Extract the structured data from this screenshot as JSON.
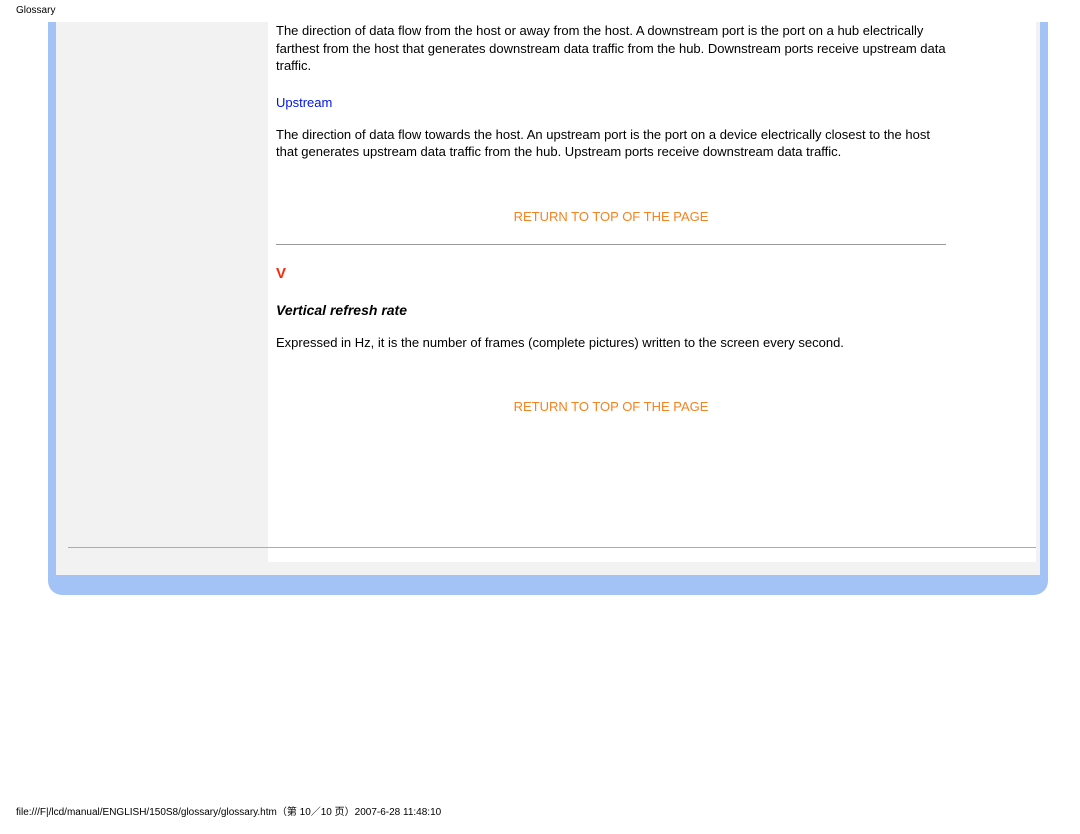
{
  "header": {
    "label": "Glossary"
  },
  "content": {
    "downstream_paragraph": "The direction of data flow from the host or away from the host. A downstream port is the port on a hub electrically farthest from the host that generates downstream data traffic from the hub. Downstream ports receive upstream data traffic.",
    "upstream_term": "Upstream",
    "upstream_paragraph": "The direction of data flow towards the host. An upstream port is the port on a device electrically closest to the host that generates upstream data traffic from the hub. Upstream ports receive downstream data traffic.",
    "return_link_1": "RETURN TO TOP OF THE PAGE",
    "section_v": "V",
    "vertical_term": "Vertical refresh rate",
    "vertical_paragraph": "Expressed in Hz, it is the number of frames (complete pictures) written to the screen every second.",
    "return_link_2": "RETURN TO TOP OF THE PAGE"
  },
  "footer": {
    "text": "file:///F|/lcd/manual/ENGLISH/150S8/glossary/glossary.htm（第 10／10 页）2007-6-28 11:48:10"
  }
}
